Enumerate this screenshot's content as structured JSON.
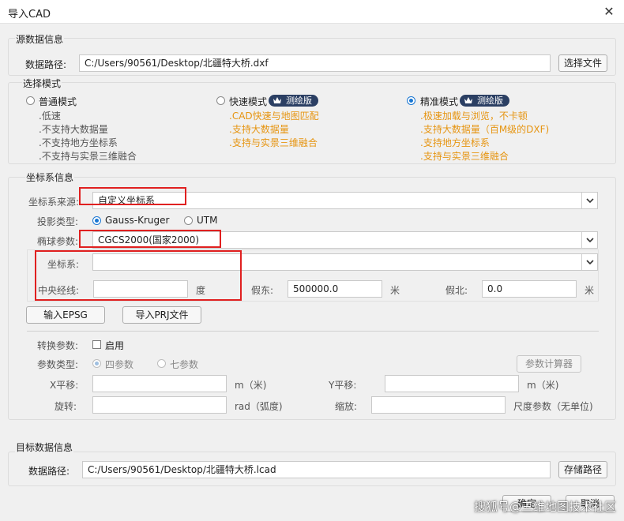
{
  "window": {
    "title": "导入CAD",
    "close_icon": "close-icon"
  },
  "source": {
    "title": "源数据信息",
    "path_label": "数据路径:",
    "path_value": "C:/Users/90561/Desktop/北疆特大桥.dxf",
    "select_button": "选择文件"
  },
  "mode": {
    "title": "选择模式",
    "options": [
      {
        "label": "普通模式",
        "selected": false,
        "badge": "",
        "features": [
          ".低速",
          ".不支持大数据量",
          ".不支持地方坐标系",
          ".不支持与实景三维融合"
        ],
        "color": "#555555"
      },
      {
        "label": "快速模式",
        "selected": false,
        "badge": "测绘版",
        "features": [
          ".CAD快速与地图匹配",
          ".支持大数据量",
          ".支持与实景三维融合"
        ],
        "color": "#e69512"
      },
      {
        "label": "精准模式",
        "selected": true,
        "badge": "测绘版",
        "features": [
          ".极速加载与浏览，不卡顿",
          ".支持大数据量（百M级的DXF)",
          ".支持地方坐标系",
          ".支持与实景三维融合"
        ],
        "color": "#e69512"
      }
    ]
  },
  "crs": {
    "title": "坐标系信息",
    "source_label": "坐标系来源:",
    "source_value": "自定义坐标系",
    "projection_label": "投影类型:",
    "projection_options": [
      "Gauss-Kruger",
      "UTM"
    ],
    "projection_selected": "Gauss-Kruger",
    "ellipsoid_label": "椭球参数:",
    "ellipsoid_value": "CGCS2000(国家2000)",
    "system_label": "坐标系:",
    "system_value": "",
    "meridian_label": "中央经线:",
    "meridian_value": "",
    "meridian_unit": "度",
    "false_east_label": "假东:",
    "false_east_value": "500000.0",
    "false_east_unit": "米",
    "false_north_label": "假北:",
    "false_north_value": "0.0",
    "false_north_unit": "米",
    "epsg_button": "输入EPSG",
    "prj_button": "导入PRJ文件",
    "transform_label": "转换参数:",
    "enable_label": "启用",
    "param_type_label": "参数类型:",
    "param_types": [
      "四参数",
      "七参数"
    ],
    "param_type_selected": "四参数",
    "calc_button": "参数计算器",
    "x_shift_label": "X平移:",
    "x_shift_unit": "m（米)",
    "y_shift_label": "Y平移:",
    "y_shift_unit": "m（米)",
    "rotate_label": "旋转:",
    "rotate_unit": "rad（弧度)",
    "scale_label": "缩放:",
    "scale_unit": "尺度参数（无单位)"
  },
  "target": {
    "title": "目标数据信息",
    "path_label": "数据路径:",
    "path_value": "C:/Users/90561/Desktop/北疆特大桥.lcad",
    "save_button": "存储路径"
  },
  "footer": {
    "ok_button": "确定",
    "cancel_button": "取消",
    "watermark": "搜狐号@三维地图技术社区"
  },
  "colors": {
    "accent": "#1976d2",
    "highlight": "#e02020",
    "feature_orange": "#e69512",
    "badge_bg": "#2b3f63"
  }
}
